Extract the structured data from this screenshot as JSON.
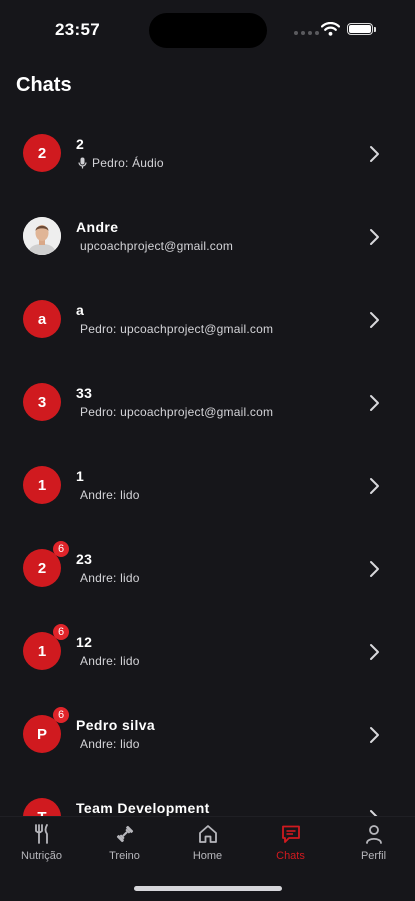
{
  "status": {
    "time": "23:57"
  },
  "page": {
    "title": "Chats"
  },
  "chats": [
    {
      "avatar": "2",
      "name": "2",
      "preview": "Pedro: Áudio",
      "badge": "",
      "preview_icon": "mic-icon"
    },
    {
      "avatar": "",
      "avatar_type": "photo",
      "name": "Andre",
      "preview": "upcoachproject@gmail.com",
      "badge": ""
    },
    {
      "avatar": "a",
      "name": "a",
      "preview": "Pedro: upcoachproject@gmail.com",
      "badge": ""
    },
    {
      "avatar": "3",
      "name": "33",
      "preview": "Pedro: upcoachproject@gmail.com",
      "badge": ""
    },
    {
      "avatar": "1",
      "name": "1",
      "preview": "Andre: lido",
      "badge": ""
    },
    {
      "avatar": "2",
      "name": "23",
      "preview": "Andre: lido",
      "badge": "6"
    },
    {
      "avatar": "1",
      "name": "12",
      "preview": "Andre: lido",
      "badge": "6"
    },
    {
      "avatar": "P",
      "name": "Pedro silva",
      "preview": "Andre: lido",
      "badge": "6"
    },
    {
      "avatar": "T",
      "name": "Team Development",
      "preview": "",
      "badge": ""
    }
  ],
  "tabs": [
    {
      "label": "Nutrição",
      "icon": "fork-knife-icon",
      "active": false
    },
    {
      "label": "Treino",
      "icon": "dumbbell-icon",
      "active": false
    },
    {
      "label": "Home",
      "icon": "home-icon",
      "active": false
    },
    {
      "label": "Chats",
      "icon": "chat-icon",
      "active": true
    },
    {
      "label": "Perfil",
      "icon": "person-icon",
      "active": false
    }
  ],
  "colors": {
    "accent": "#d01a1f",
    "background": "#16161a",
    "badge": "#e0242a"
  }
}
